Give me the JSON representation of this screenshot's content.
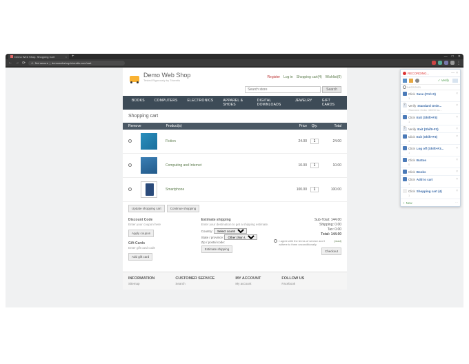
{
  "browser": {
    "tab_title": "Demo Web Shop. Shopping Cart",
    "url_warning": "Not secure",
    "url": "demowebshop.tricentis.com/cart"
  },
  "header": {
    "brand": "Demo Web Shop",
    "tagline": "Tested Rigorously by Tricentis",
    "links": {
      "register": "Register",
      "login": "Log in",
      "cart": "Shopping cart(4)",
      "wishlist": "Wishlist(0)"
    },
    "search_placeholder": "Search store",
    "search_btn": "Search"
  },
  "nav": [
    "BOOKS",
    "COMPUTERS",
    "ELECTRONICS",
    "APPAREL & SHOES",
    "DIGITAL DOWNLOADS",
    "JEWELRY",
    "GIFT CARDS"
  ],
  "page_title": "Shopping cart",
  "cart": {
    "cols": {
      "remove": "Remove",
      "product": "Product(s)",
      "price": "Price",
      "qty": "Qty.",
      "total": "Total"
    },
    "rows": [
      {
        "name": "Fiction",
        "price": "24.00",
        "qty": "1",
        "total": "24.00"
      },
      {
        "name": "Computing and Internet",
        "price": "10.00",
        "qty": "1",
        "total": "10.00"
      },
      {
        "name": "Smartphone",
        "price": "100.00",
        "qty": "1",
        "total": "100.00"
      }
    ],
    "update_btn": "Update shopping cart",
    "continue_btn": "Continue shopping"
  },
  "discount": {
    "title": "Discount Code",
    "hint": "Enter your coupon here",
    "btn": "Apply coupon"
  },
  "giftcard": {
    "title": "Gift Cards",
    "hint": "Enter gift card code",
    "btn": "Add gift card"
  },
  "shipping": {
    "title": "Estimate shipping",
    "hint": "Enter your destination to get a shipping estimate.",
    "country_lbl": "Country:",
    "country_val": "Select country",
    "state_lbl": "State / province:",
    "state_val": "Other (Non US)",
    "zip_lbl": "Zip / postal code:",
    "btn": "Estimate shipping"
  },
  "totals": {
    "subtotal_lbl": "Sub-Total:",
    "subtotal": "144.00",
    "shipping_lbl": "Shipping:",
    "shipping": "0.00",
    "tax_lbl": "Tax:",
    "tax": "0.00",
    "total_lbl": "Total:",
    "total": "144.00",
    "terms": "I agree with the terms of service and I adhere to them unconditionally",
    "terms_link": "(read)",
    "checkout": "Checkout"
  },
  "footer": {
    "c1": {
      "h": "INFORMATION",
      "i": "Sitemap"
    },
    "c2": {
      "h": "CUSTOMER SERVICE",
      "i": "Search"
    },
    "c3": {
      "h": "MY ACCOUNT",
      "i": "My account"
    },
    "c4": {
      "h": "FOLLOW US",
      "i": "Facebook"
    }
  },
  "panel": {
    "recording": "RECORDING...",
    "verify_btn": "Verify",
    "session_date": "04/22/2021",
    "steps": [
      {
        "type": "click",
        "act": "Click",
        "tgt": "Save  (Ctrl+S)",
        "sub": "1"
      },
      {
        "type": "verify",
        "act": "Verify",
        "tgt": "Standard Orde...",
        "sub": "Standard Order 45000 ha..."
      },
      {
        "type": "click",
        "act": "Click",
        "tgt": "Exit (Shift+F3)",
        "sub": "1"
      },
      {
        "type": "verify",
        "act": "Verify",
        "tgt": "Exit (Shift+F3)",
        "sub": ""
      },
      {
        "type": "click",
        "act": "Click",
        "tgt": "Exit (Shift+F3)",
        "sub": "1"
      },
      {
        "type": "click",
        "act": "Click",
        "tgt": "Log off   (Shift+F3...",
        "sub": "1"
      },
      {
        "type": "click",
        "act": "Click",
        "tgt": "Button",
        "sub": "0"
      },
      {
        "type": "click",
        "act": "Click",
        "tgt": "Books",
        "sub": ""
      },
      {
        "type": "click",
        "act": "Click",
        "tgt": "Add to cart",
        "sub": "1"
      },
      {
        "type": "cart",
        "act": "Click",
        "tgt": "Shopping cart (4)",
        "sub": "1"
      }
    ],
    "new_step": "New"
  }
}
